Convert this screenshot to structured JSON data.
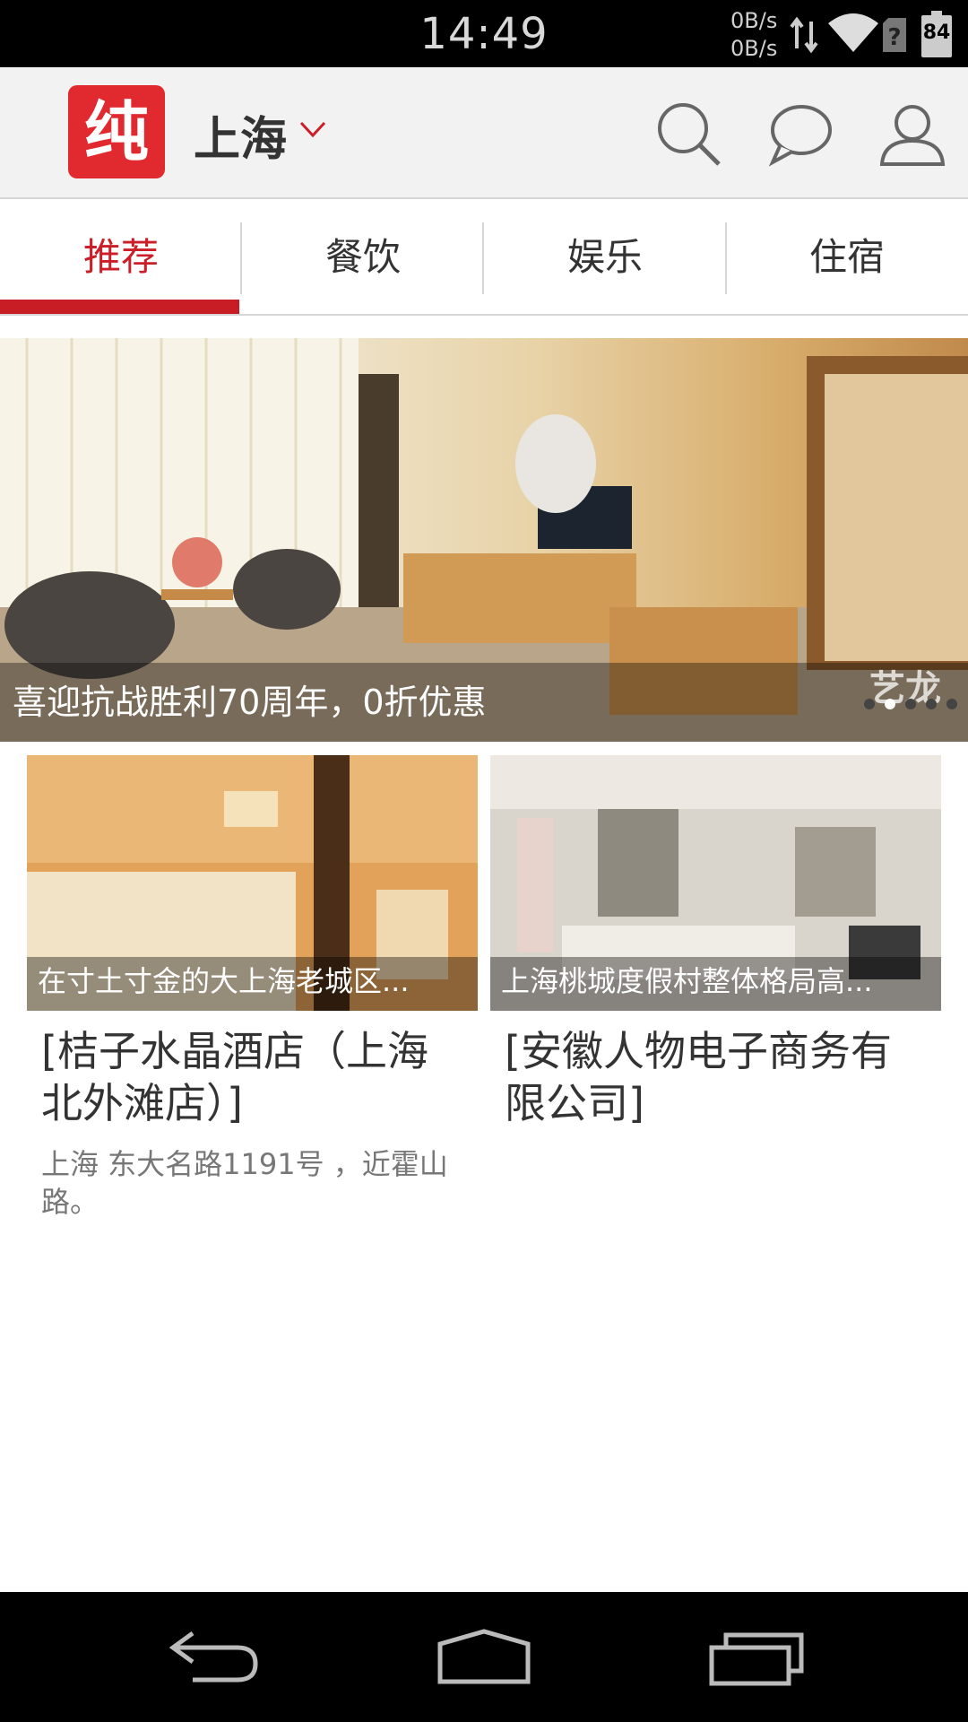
{
  "status_bar": {
    "time": "14:49",
    "net_up": "0B/s",
    "net_down": "0B/s",
    "battery": "84"
  },
  "header": {
    "logo_text": "纯",
    "city": "上海",
    "icons": [
      "search-icon",
      "message-icon",
      "user-icon"
    ]
  },
  "tabs": [
    {
      "label": "推荐",
      "active": true
    },
    {
      "label": "餐饮",
      "active": false
    },
    {
      "label": "娱乐",
      "active": false
    },
    {
      "label": "住宿",
      "active": false
    }
  ],
  "banner": {
    "caption": "喜迎抗战胜利70周年，0折优惠",
    "watermark": "艺龙",
    "page_count": 5,
    "current_page": 2
  },
  "cards": [
    {
      "image_caption": "在寸土寸金的大上海老城区...",
      "title": "[桔子水晶酒店（上海北外滩店）]",
      "address": "上海 东大名路1191号 ，近霍山路。"
    },
    {
      "image_caption": "上海桃城度假村整体格局高...",
      "title": "[安徽人物电子商务有限公司]",
      "address": ""
    }
  ],
  "colors": {
    "accent": "#c81d25",
    "header_bg": "#f2f2f2",
    "status_bar_bg": "#000000"
  }
}
